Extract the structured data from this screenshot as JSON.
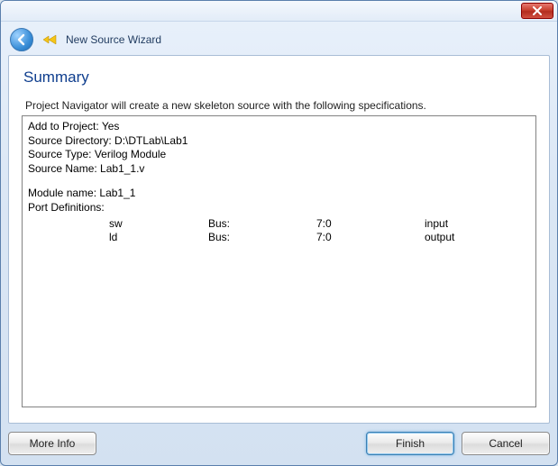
{
  "window": {
    "title": "New Source Wizard"
  },
  "summary": {
    "heading": "Summary",
    "intro": "Project Navigator will create a new skeleton source with the following specifications."
  },
  "details": {
    "add_to_project_label": "Add to Project:",
    "add_to_project_value": "Yes",
    "source_directory_label": "Source Directory:",
    "source_directory_value": "D:\\DTLab\\Lab1",
    "source_type_label": "Source Type:",
    "source_type_value": "Verilog Module",
    "source_name_label": "Source Name:",
    "source_name_value": "Lab1_1.v",
    "module_name_label": "Module name:",
    "module_name_value": "Lab1_1",
    "port_defs_label": "Port Definitions:",
    "ports": [
      {
        "name": "sw",
        "bus": "Bus:",
        "range": "7:0",
        "dir": "input"
      },
      {
        "name": "ld",
        "bus": "Bus:",
        "range": "7:0",
        "dir": "output"
      }
    ]
  },
  "buttons": {
    "more_info": "More Info",
    "finish": "Finish",
    "cancel": "Cancel"
  }
}
